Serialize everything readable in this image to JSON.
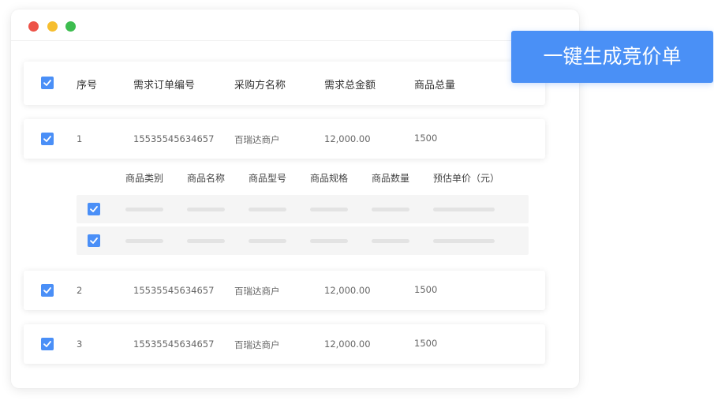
{
  "window": {
    "controls": [
      "close",
      "minimize",
      "maximize"
    ]
  },
  "table": {
    "headers": {
      "index": "序号",
      "order_no": "需求订单编号",
      "buyer": "采购方名称",
      "amount": "需求总金额",
      "quantity": "商品总量"
    },
    "rows": [
      {
        "index": "1",
        "order_no": "15535545634657",
        "buyer": "百瑞达商户",
        "amount": "12,000.00",
        "quantity": "1500",
        "checked": true
      },
      {
        "index": "2",
        "order_no": "15535545634657",
        "buyer": "百瑞达商户",
        "amount": "12,000.00",
        "quantity": "1500",
        "checked": true
      },
      {
        "index": "3",
        "order_no": "15535545634657",
        "buyer": "百瑞达商户",
        "amount": "12,000.00",
        "quantity": "1500",
        "checked": true
      }
    ]
  },
  "subtable": {
    "headers": {
      "category": "商品类别",
      "name": "商品名称",
      "model": "商品型号",
      "spec": "商品规格",
      "count": "商品数量",
      "unit_price": "预估单价（元）"
    },
    "rows_checked": [
      true,
      true
    ]
  },
  "cta": {
    "label": "一键生成竞价单"
  },
  "colors": {
    "accent": "#4a90f6",
    "checkbox": "#4a8ff7"
  }
}
